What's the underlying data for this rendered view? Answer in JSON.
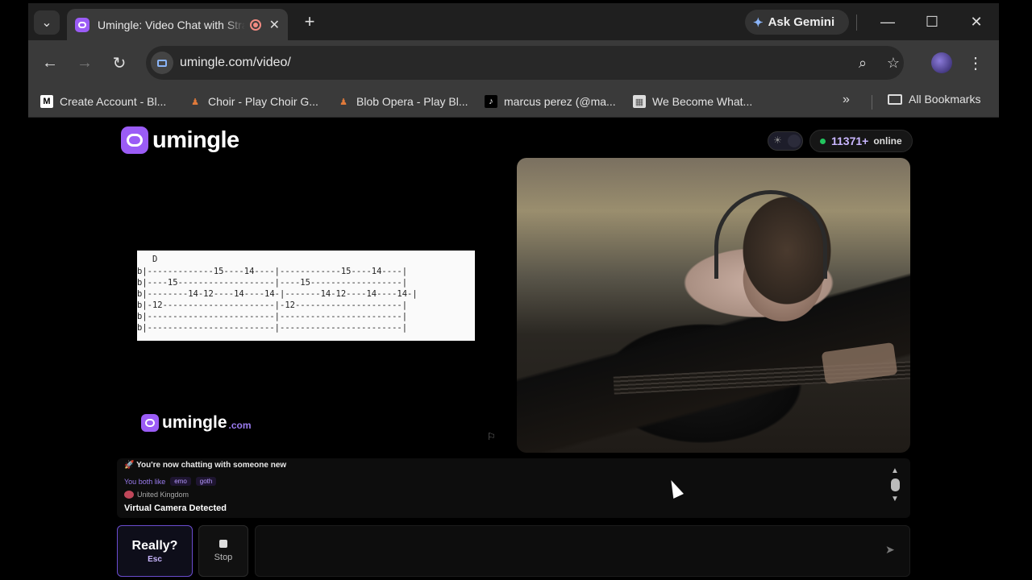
{
  "browser": {
    "tab": {
      "title": "Umingle: Video Chat with Strangers",
      "close": "✕"
    },
    "new_tab": "+",
    "gemini_label": "Ask Gemini",
    "window_controls": {
      "minimize": "—",
      "maximize": "☐",
      "close": "✕"
    },
    "nav": {
      "back": "←",
      "forward": "→",
      "reload": "↻"
    },
    "url": "umingle.com/video/",
    "icons": {
      "zoom": "⌕",
      "bookmark_star": "☆",
      "menu": "⋮"
    },
    "bookmarks": [
      {
        "label": "Create Account - Bl...",
        "icon": "M"
      },
      {
        "label": "Choir - Play Choir G...",
        "icon": "♟"
      },
      {
        "label": "Blob Opera - Play Bl...",
        "icon": "♟"
      },
      {
        "label": "marcus perez (@ma...",
        "icon": "♪"
      },
      {
        "label": "We Become What...",
        "icon": "▦"
      }
    ],
    "bookmarks_more": "»",
    "all_bookmarks": "All Bookmarks"
  },
  "site": {
    "logo_text": "umingle",
    "online_count": "11371+",
    "online_label": "online",
    "watermark_text": "umingle",
    "watermark_suffix": ".com",
    "flag_icon": "⚐"
  },
  "guitar_tab": {
    "chord": "D",
    "lines": [
      "b|-------------15----14----|------------15----14----|",
      "b|----15-------------------|----15------------------|",
      "b|--------14-12----14----14-|-------14-12----14----14-|",
      "b|-12----------------------|-12---------------------|",
      "b|-------------------------|------------------------|",
      "b|-------------------------|------------------------|"
    ]
  },
  "chat": {
    "line1": "You're now chatting with someone new",
    "line1_icon": "🚀",
    "likes_label": "You both like",
    "likes": [
      "emo",
      "goth"
    ],
    "country": "United Kingdom",
    "warning": "Virtual Camera Detected",
    "scroll_up": "▲",
    "scroll_down": "▼"
  },
  "controls": {
    "really_label": "Really?",
    "really_hint": "Esc",
    "stop_label": "Stop",
    "message_placeholder": "",
    "send_icon": "➤"
  },
  "colors": {
    "accent": "#9b5cf6",
    "online_dot": "#22c55e"
  }
}
